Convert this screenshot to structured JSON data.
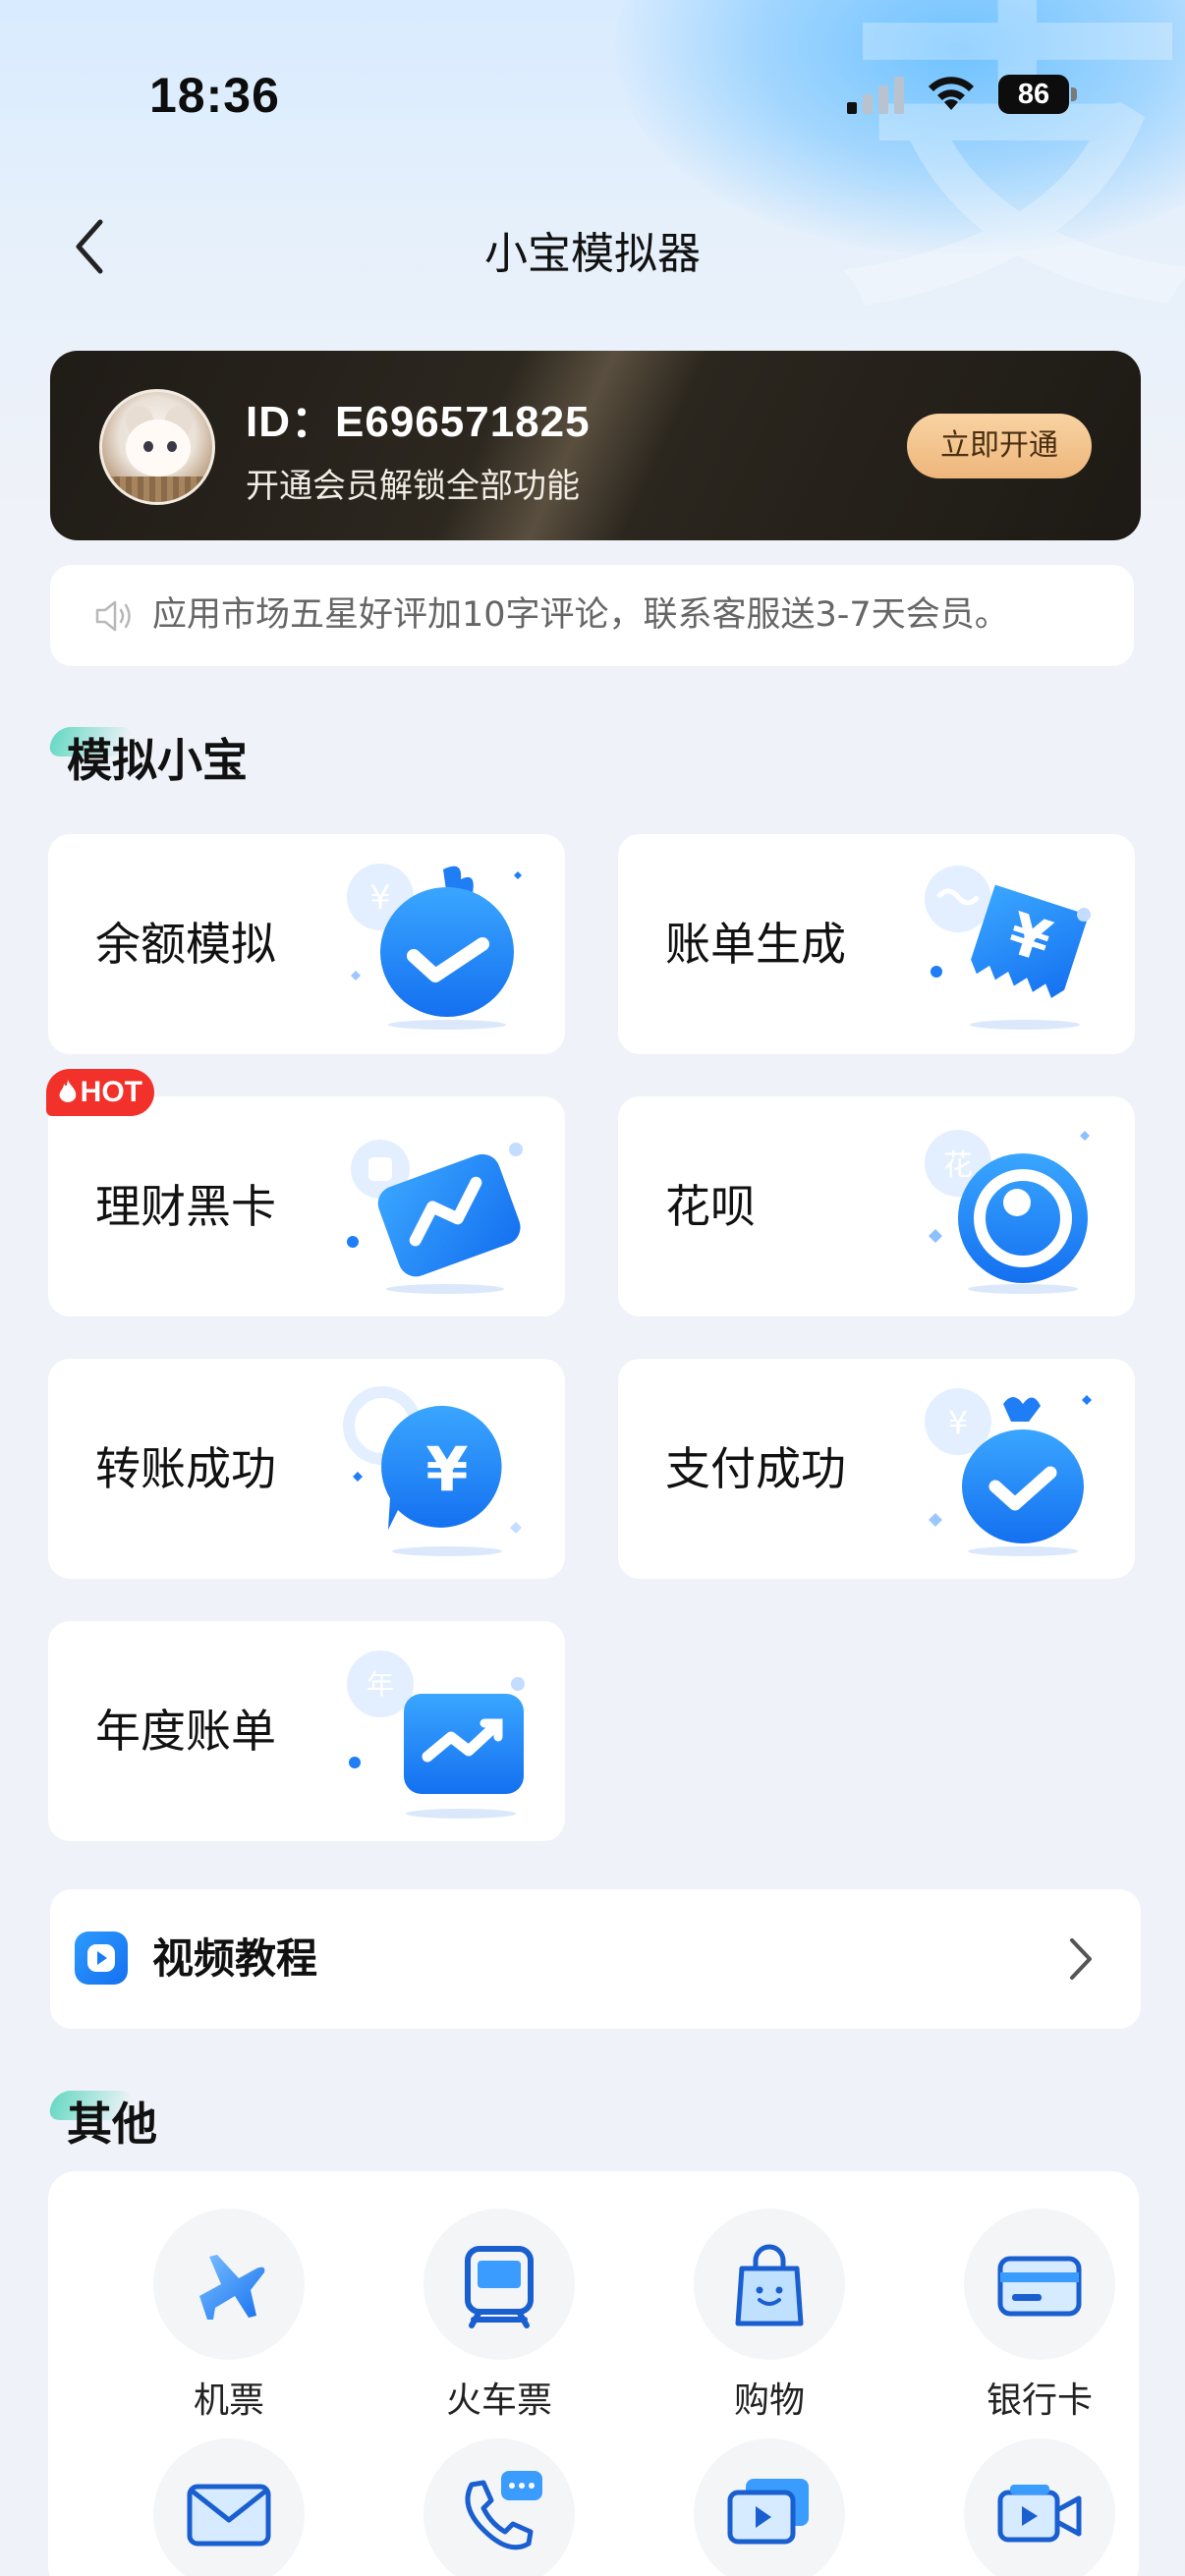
{
  "status_bar": {
    "time": "18:36",
    "battery": "86"
  },
  "nav": {
    "title": "小宝模拟器",
    "back_icon": "back-chevron-icon"
  },
  "member": {
    "id_text": "ID：E696571825",
    "subtitle": "开通会员解锁全部功能",
    "button": "立即开通",
    "colors": {
      "card": "#231f19",
      "button": "#f3c58d"
    }
  },
  "notice": {
    "text": "应用市场五星好评加10字评论，联系客服送3-7天会员。",
    "icon": "speaker-icon"
  },
  "section_simulate": {
    "title": "模拟小宝"
  },
  "features": [
    {
      "label": "余额模拟",
      "icon": "money-bag-check-icon",
      "badge": ""
    },
    {
      "label": "账单生成",
      "icon": "yen-ticket-icon",
      "badge": ""
    },
    {
      "label": "理财黑卡",
      "icon": "card-chart-icon",
      "badge": "HOT"
    },
    {
      "label": "花呗",
      "icon": "huabei-logo-icon",
      "badge": ""
    },
    {
      "label": "转账成功",
      "icon": "yen-chat-icon",
      "badge": ""
    },
    {
      "label": "支付成功",
      "icon": "pouch-check-icon",
      "badge": ""
    },
    {
      "label": "年度账单",
      "icon": "trend-chart-icon",
      "badge": ""
    }
  ],
  "video": {
    "label": "视频教程",
    "icon": "play-icon"
  },
  "section_other": {
    "title": "其他"
  },
  "others": [
    {
      "label": "机票",
      "icon": "airplane-icon"
    },
    {
      "label": "火车票",
      "icon": "train-icon"
    },
    {
      "label": "购物",
      "icon": "shopping-bag-icon"
    },
    {
      "label": "银行卡",
      "icon": "bank-card-icon"
    },
    {
      "label": "",
      "icon": "envelope-icon"
    },
    {
      "label": "",
      "icon": "phone-message-icon"
    },
    {
      "label": "",
      "icon": "video-message-icon"
    },
    {
      "label": "",
      "icon": "video-camera-icon"
    }
  ],
  "accent_color": "#1a7cf5"
}
